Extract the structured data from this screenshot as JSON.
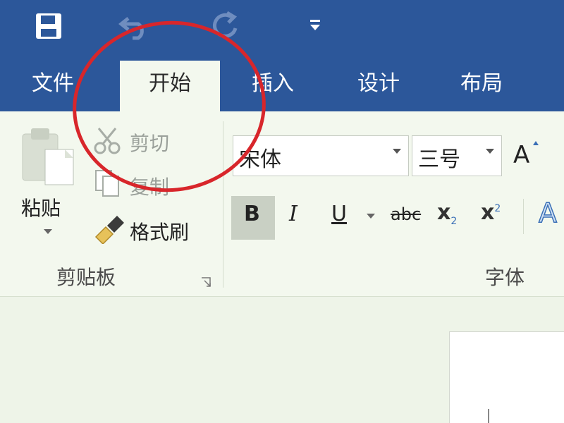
{
  "quick_access": {
    "icons": [
      "save-icon",
      "undo-icon",
      "redo-icon",
      "customize-quick-access-icon"
    ]
  },
  "tabs": [
    "文件",
    "开始",
    "插入",
    "设计",
    "布局"
  ],
  "active_tab": "开始",
  "clipboard": {
    "paste_label": "粘贴",
    "cut_label": "剪切",
    "copy_label": "复制",
    "format_painter_label": "格式刷",
    "group_label": "剪贴板"
  },
  "font": {
    "font_name": "宋体",
    "font_size": "三号",
    "bold": "B",
    "italic": "I",
    "underline": "U",
    "strikethrough": "abc",
    "subscript_base": "x",
    "subscript_mark": "2",
    "superscript_base": "x",
    "superscript_mark": "2",
    "grow_font": "A",
    "text_effects": "A",
    "group_label": "字体"
  },
  "colors": {
    "title_bar": "#2c579a",
    "ribbon": "#f3f8ee",
    "annotation_circle": "#d8262b"
  }
}
